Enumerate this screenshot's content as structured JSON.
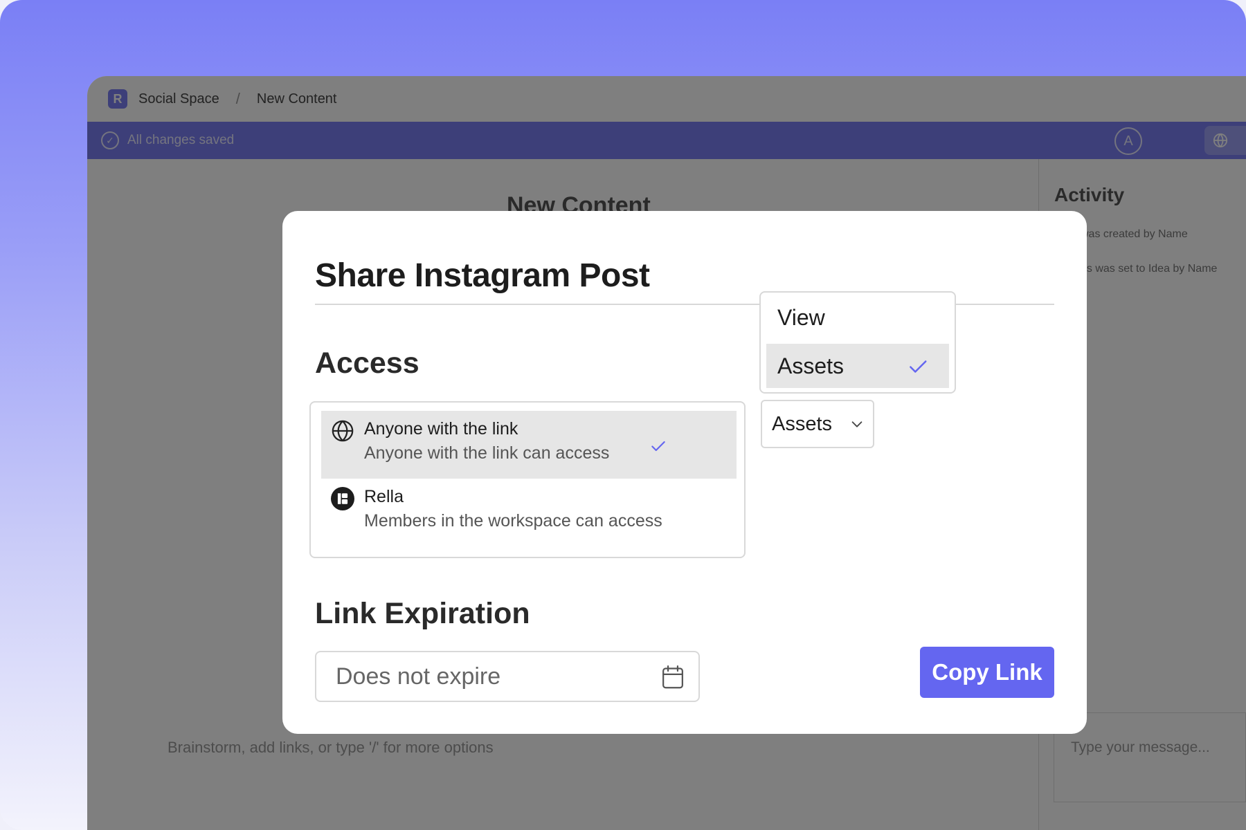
{
  "background_app": {
    "breadcrumb": {
      "workspace": "Social Space",
      "page": "New Content"
    },
    "status": "All changes saved",
    "avatar_letter": "A",
    "editor_title": "New Content",
    "activity": {
      "title": "Activity",
      "lines": [
        "was created by Name",
        "us was set to Idea by Name"
      ]
    },
    "editor_placeholder": "Brainstorm, add links, or type '/' for more options",
    "message_placeholder": "Type your message..."
  },
  "modal": {
    "title": "Share Instagram Post",
    "access_label": "Access",
    "access_options": [
      {
        "title": "Anyone with the link",
        "subtitle": "Anyone with the link can access",
        "selected": true
      },
      {
        "title": "Rella",
        "subtitle": "Members in the workspace can access",
        "selected": false
      }
    ],
    "permission_select": {
      "value": "Assets"
    },
    "permission_dropdown": {
      "options": [
        {
          "label": "View",
          "selected": false
        },
        {
          "label": "Assets",
          "selected": true
        }
      ]
    },
    "expiration_label": "Link Expiration",
    "expiration_input": {
      "value": "Does not expire"
    },
    "copy_button": "Copy Link"
  },
  "colors": {
    "accent": "#6466f0",
    "check": "#6466f0",
    "overlay": "rgba(0,0,0,0.5)"
  }
}
